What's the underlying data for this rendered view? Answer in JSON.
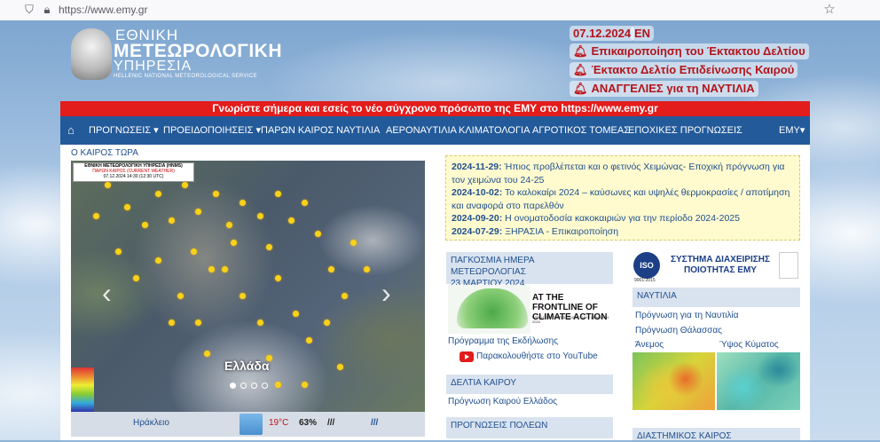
{
  "browser": {
    "url": "https://www.emy.gr"
  },
  "logo": {
    "line1": "ΕΘΝΙΚΗ",
    "line2": "ΜΕΤΕΩΡΟΛΟΓΙΚΗ",
    "line3": "ΥΠΗΡΕΣΙΑ",
    "line4": "HELLENIC NATIONAL METEOROLOGICAL SERVICE"
  },
  "header": {
    "date": "07.12.2024",
    "lang": "EN",
    "alerts": [
      "Επικαιροποίηση του Έκτακτου Δελτίου",
      "Έκτακτο Δελτίο Επιδείνωσης Καιρού",
      "ΑΝΑΓΓΕΛΙΕΣ για τη ΝΑΥΤΙΛΙΑ"
    ]
  },
  "banner": "Γνωρίστε σήμερα και εσείς το νέο σύγχρονο πρόσωπο της ΕΜΥ στο https://www.emy.gr",
  "nav": {
    "items": [
      "ΠΡΟΓΝΩΣΕΙΣ ▾",
      "ΠΡΟΕΙΔΟΠΟΙΗΣΕΙΣ ▾",
      "ΠΑΡΩΝ ΚΑΙΡΟΣ",
      "ΝΑΥΤΙΛΙΑ",
      "ΑΕΡΟΝΑΥΤΙΛΙΑ",
      "ΚΛΙΜΑΤΟΛΟΓΙΑ",
      "ΑΓΡΟΤΙΚΟΣ ΤΟΜΕΑΣ",
      "ΕΠΟΧΙΚΕΣ ΠΡΟΓΝΩΣΕΙΣ"
    ],
    "right": "ΕΜΥ▾"
  },
  "weather_now": {
    "title": "Ο ΚΑΙΡΟΣ ΤΩΡΑ",
    "map_label1": "ΕΘΝΙΚΗ ΜΕΤΕΩΡΟΛΟΓΙΚΗ ΥΠΗΡΕΣΙΑ (HNMS)",
    "map_label2": "ΠΑΡΩΝ ΚΑΙΡΟΣ (CURRENT WEATHER)",
    "map_label3": "07.12.2024 14:30 (12:30 UTC)",
    "caption": "Ελλάδα",
    "slides": 4,
    "active_slide": 1,
    "row": {
      "city": "Ηράκλειο",
      "temp": "19°C",
      "humidity": "63%",
      "wind1": "///",
      "wind2": "///"
    }
  },
  "news": [
    {
      "date": "2024-11-29:",
      "text": " Ήπιος προβλέπεται και ο φετινός Χειμώνας- Εποχική πρόγνωση για τον χειμώνα του 24-25"
    },
    {
      "date": "2024-10-02:",
      "text": " Το καλοκαίρι 2024 – καύσωνες και υψηλές θερμοκρασίες / αποτίμηση και αναφορά στο παρελθόν"
    },
    {
      "date": "2024-09-20:",
      "text": " Η ονοματοδοσία κακοκαιριών για την περίοδο 2024-2025"
    },
    {
      "date": "2024-07-29:",
      "text": " ΞΗΡΑΣΙΑ - Επικαιροποίηση"
    }
  ],
  "wmo": {
    "heading1": "ΠΑΓΚΟΣΜΙΑ ΗΜΕΡΑ ΜΕΤΕΩΡΟΛΟΓΙΑΣ",
    "heading2": "23 ΜΑΡΤΙΟΥ 2024",
    "image_text": "AT THE FRONTLINE OF CLIMATE ACTION",
    "image_sub": "WORLD METEOROLOGICAL DAY · 23 MARCH 2024",
    "link1": "Πρόγραμμα της Εκδήλωσης",
    "link2": "Παρακολουθήστε στο YouTube"
  },
  "bulletins": {
    "heading": "ΔΕΛΤΙΑ ΚΑΙΡΟΥ",
    "link": "Πρόγνωση Καιρού Ελλάδος"
  },
  "cities": {
    "heading": "ΠΡΟΓΝΩΣΕΙΣ ΠΟΛΕΩΝ"
  },
  "iso": {
    "logo": "ISO",
    "text": "ΣΥΣΤΗΜΑ ΔΙΑΧΕΙΡΙΣΗΣ ΠΟΙΟΤΗΤΑΣ ΕΜΥ",
    "cert": "9001:2015"
  },
  "shipping": {
    "heading": "ΝΑΥΤΙΛΙΑ",
    "link1": "Πρόγνωση για τη Ναυτιλία",
    "link2": "Πρόγνωση Θάλασσας",
    "col1": "Άνεμος",
    "col2": "Ύψος Κύματος"
  },
  "space": {
    "heading": "ΔΙΑΣΤΗΜΙΚΟΣ ΚΑΙΡΟΣ"
  }
}
